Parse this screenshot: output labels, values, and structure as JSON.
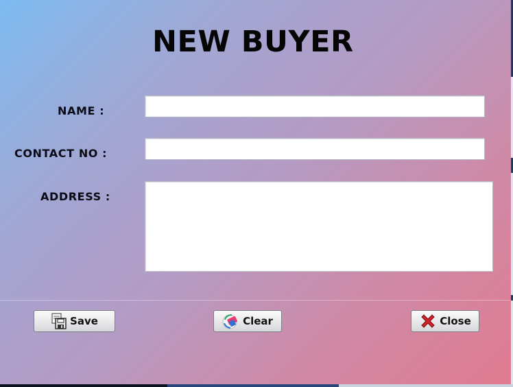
{
  "form": {
    "title": "NEW BUYER",
    "fields": {
      "name": {
        "label": "NAME :",
        "value": ""
      },
      "contact": {
        "label": "CONTACT NO :",
        "value": ""
      },
      "address": {
        "label": "ADDRESS :",
        "value": ""
      }
    }
  },
  "buttons": {
    "save": {
      "label": "Save",
      "icon": "floppy-disk-icon"
    },
    "clear": {
      "label": "Clear",
      "icon": "eraser-icon"
    },
    "close": {
      "label": "Close",
      "icon": "red-x-icon"
    }
  },
  "colors": {
    "background_gradient": [
      "#7dbbf0",
      "#b49bc4",
      "#e07a91"
    ],
    "close_icon": "#d0232a"
  }
}
